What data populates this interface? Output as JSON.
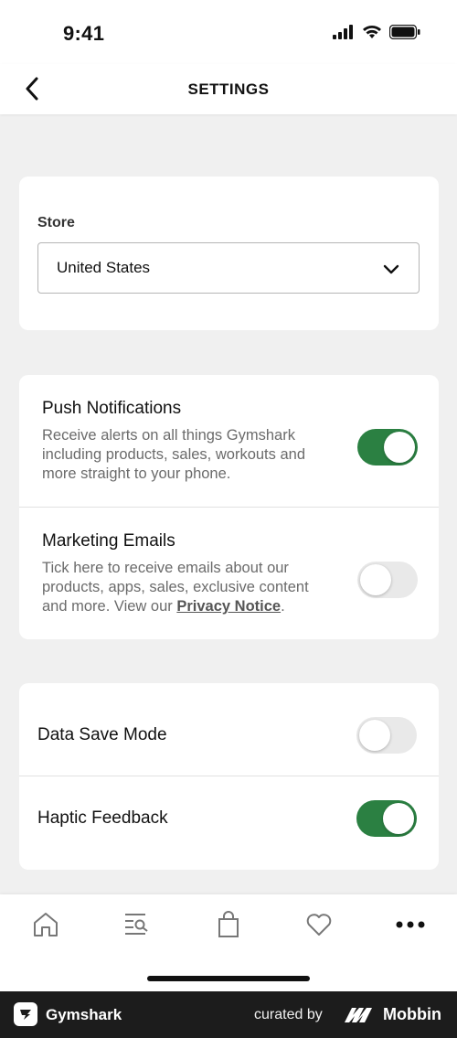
{
  "status_bar": {
    "time": "9:41"
  },
  "nav": {
    "title": "SETTINGS"
  },
  "store": {
    "label": "Store",
    "selected": "United States"
  },
  "notifications": {
    "push": {
      "title": "Push Notifications",
      "description": "Receive alerts on all things Gymshark including products, sales, workouts and more straight to your phone.",
      "enabled": true
    },
    "marketing": {
      "title": "Marketing Emails",
      "description_prefix": "Tick here to receive emails about our products, apps, sales, exclusive content and more. View our ",
      "link_text": "Privacy Notice",
      "description_suffix": ".",
      "enabled": false
    }
  },
  "misc": {
    "data_save": {
      "label": "Data Save Mode",
      "enabled": false
    },
    "haptic": {
      "label": "Haptic Feedback",
      "enabled": true
    }
  },
  "tabs": [
    {
      "icon": "home-icon"
    },
    {
      "icon": "search-list-icon"
    },
    {
      "icon": "bag-icon"
    },
    {
      "icon": "heart-icon"
    },
    {
      "icon": "more-icon"
    }
  ],
  "footer": {
    "brand": "Gymshark",
    "curated": "curated by",
    "mobbin": "Mobbin"
  },
  "colors": {
    "toggle_on": "#2b8042",
    "toggle_off": "#e9e9e9",
    "background": "#f0f0f0",
    "footer": "#1c1c1c"
  }
}
